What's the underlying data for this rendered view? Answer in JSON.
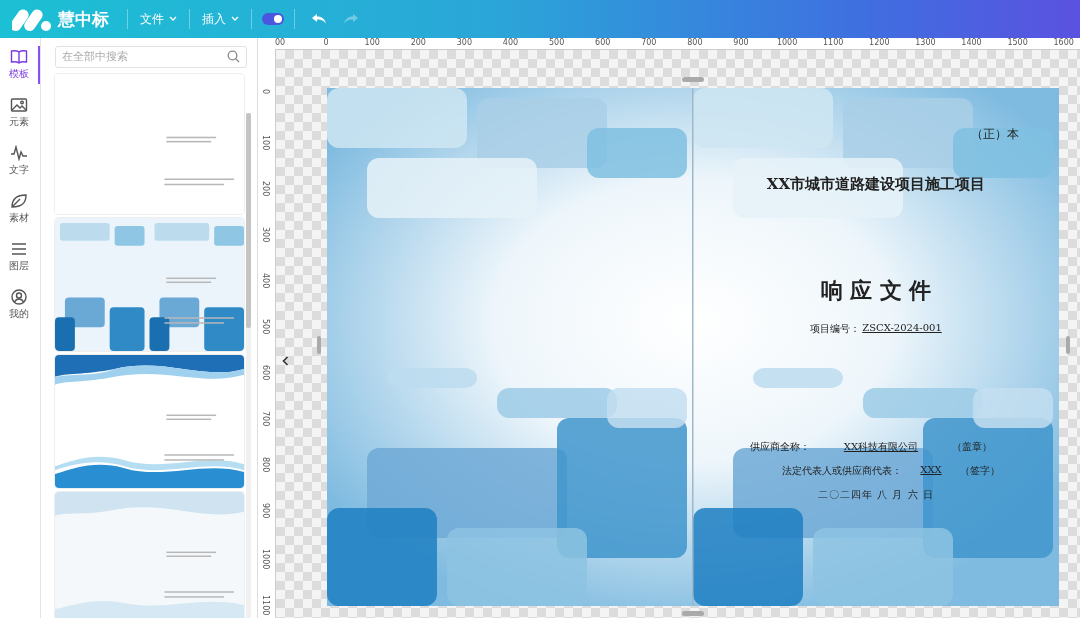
{
  "app": {
    "brand": "慧中标"
  },
  "menus": [
    {
      "label": "文件"
    },
    {
      "label": "插入"
    }
  ],
  "toggle": {
    "on": true
  },
  "history": [
    {
      "kind": "undo",
      "disabled": false
    },
    {
      "kind": "redo",
      "disabled": true
    }
  ],
  "rail": [
    {
      "label": "模板",
      "selected": true
    },
    {
      "label": "元素",
      "selected": false
    },
    {
      "label": "文字",
      "selected": false
    },
    {
      "label": "素材",
      "selected": false
    },
    {
      "label": "图层",
      "selected": false
    },
    {
      "label": "我的",
      "selected": false
    }
  ],
  "search": {
    "placeholder": "在全部中搜索"
  },
  "thumbnails": [
    {
      "kind": "plain"
    },
    {
      "kind": "tiles"
    },
    {
      "kind": "waves"
    },
    {
      "kind": "soft"
    }
  ],
  "ruler": {
    "x_ticks": [
      "00",
      "0",
      "100",
      "200",
      "300",
      "400",
      "500",
      "600",
      "700",
      "800",
      "900",
      "1000",
      "1100",
      "1200",
      "1300",
      "1400",
      "1500",
      "1600"
    ],
    "y_ticks": [
      "0",
      "100",
      "200",
      "300",
      "400",
      "500",
      "600",
      "700",
      "800",
      "900",
      "1000",
      "1100"
    ]
  },
  "document": {
    "copy_mark": "（正）本",
    "project": "XX市城市道路建设项目施工项目",
    "heading": "响 应 文 件",
    "number_label": "项目编号：",
    "number": "ZSCX-2024-001",
    "rows": [
      {
        "label": "供应商全称：",
        "value": "XX科技有限公司",
        "note": "（盖章）"
      },
      {
        "label": "法定代表人或供应商代表：",
        "value": "XXX",
        "note": "（签字）"
      }
    ],
    "date": "二〇二四年 八 月 六 日"
  }
}
